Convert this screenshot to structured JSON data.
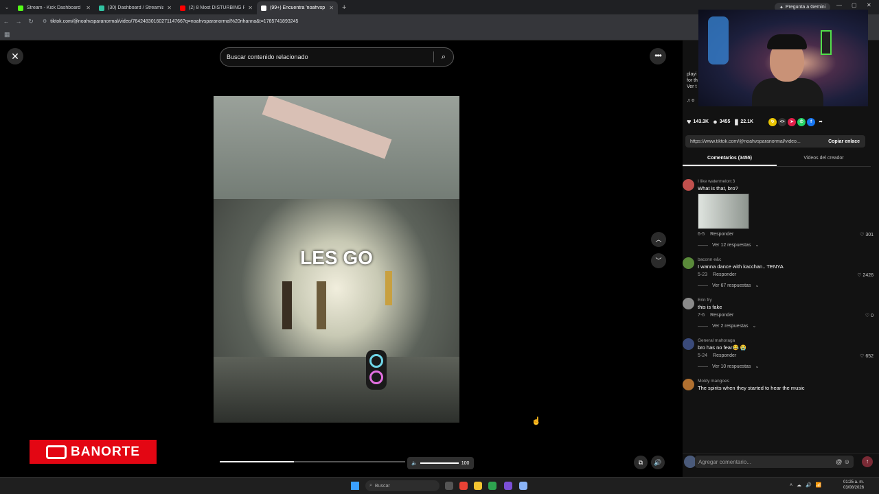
{
  "browser": {
    "tabs": [
      {
        "title": "Stream - Kick Dashboard",
        "favicon_color": "#53fc18",
        "close": "✕"
      },
      {
        "title": "(30) Dashboard / Streamlabs",
        "favicon_color": "#31c3a2",
        "close": "✕"
      },
      {
        "title": "(2) 8 Most DISTURBING Paranc",
        "favicon_color": "#ff0000",
        "close": "✕"
      },
      {
        "title": "(99+) Encuentra 'noahvsp",
        "favicon_color": "#ffffff",
        "close": "✕"
      }
    ],
    "new_tab": "+",
    "gemini_button": "Pregunta a Gemini",
    "address": "tiktok.com/@noahvsparanormal/video/7642483016027114766?q=noahvsparanormal%20rihanna&t=1785741893245"
  },
  "video_viewer": {
    "search_placeholder": "Buscar contenido relacionado",
    "overlay_text": "LES GO",
    "progress": 0.4,
    "volume_value": "100",
    "close_glyph": "✕",
    "more_glyph": "•••",
    "up_glyph": "︿",
    "down_glyph": "﹀"
  },
  "sponsor": {
    "name": "BANORTE"
  },
  "side_panel": {
    "description_snippet": "playi for th Ver t",
    "music_snippet": "♫ o",
    "stats": {
      "likes": "143.3K",
      "comments": "3455",
      "saves": "22.1K"
    },
    "share_link": "https://www.tiktok.com/@noahvsparanormal/video...",
    "copy_link_label": "Copiar enlace",
    "tabs": {
      "comments": "Comentarios (3455)",
      "creator_videos": "Videos del creador"
    },
    "comments": [
      {
        "user": "I like watermelon:3",
        "text": "What is that, bro?",
        "date": "6-5",
        "reply": "Responder",
        "likes": "301",
        "replies": "Ver 12 respuestas",
        "has_image": true,
        "avatar_color": "#c0504d"
      },
      {
        "user": "baconn e&c",
        "text": "I wanna dance with kacchan.. TENYA",
        "date": "5-23",
        "reply": "Responder",
        "likes": "2426",
        "replies": "Ver 67 respuestas",
        "has_image": false,
        "avatar_color": "#5a8a3a"
      },
      {
        "user": "Erin fry",
        "text": "this is fake",
        "date": "7-6",
        "reply": "Responder",
        "likes": "0",
        "replies": "Ver 2 respuestas",
        "has_image": false,
        "avatar_color": "#8a8a8a"
      },
      {
        "user": "General mahoraga",
        "text": "bro has no fear😂 😭",
        "date": "5-24",
        "reply": "Responder",
        "likes": "652",
        "replies": "Ver 10 respuestas",
        "has_image": false,
        "avatar_color": "#3a4a7a"
      },
      {
        "user": "Moldy mangoes",
        "text": "The spirits when they started to hear the music",
        "date": "",
        "reply": "",
        "likes": "",
        "replies": "",
        "has_image": false,
        "avatar_color": "#b07030"
      }
    ],
    "add_comment_placeholder": "Agregar comentario..."
  },
  "taskbar": {
    "search_placeholder": "Buscar",
    "time": "01:25 a. m.",
    "date": "03/08/2026"
  }
}
